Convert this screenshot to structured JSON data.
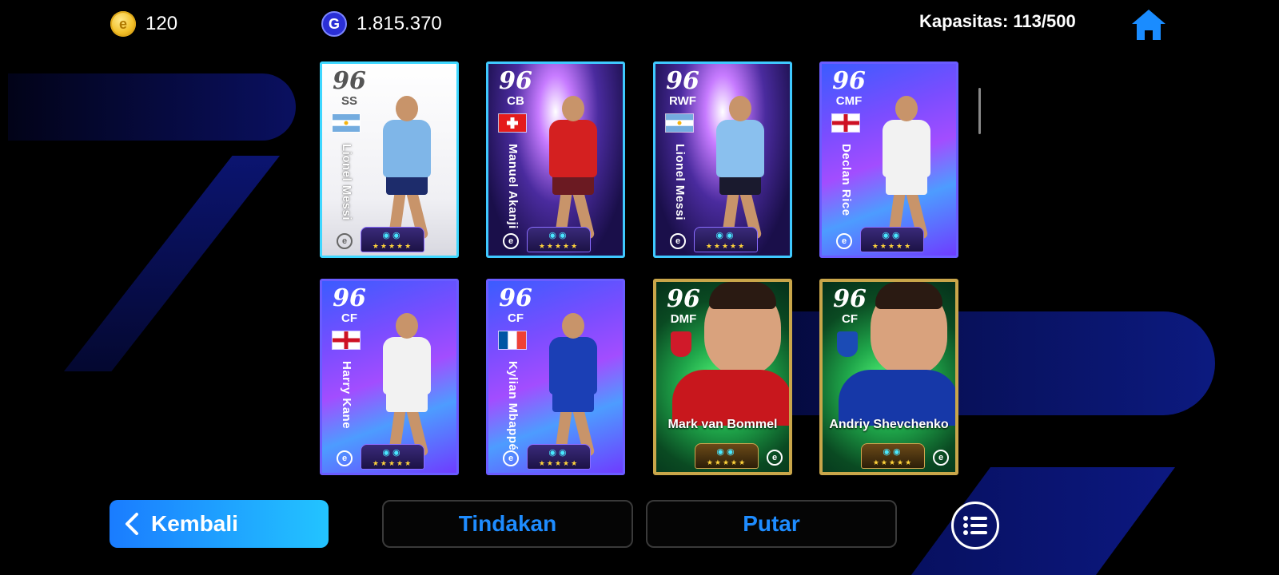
{
  "topbar": {
    "coins": "120",
    "gp": "1.815.370",
    "capacity": "Kapasitas: 113/500",
    "coin_icon": "efootball-coin-icon",
    "gp_icon": "gp-icon",
    "home_icon": "home-icon"
  },
  "cards": [
    {
      "rating": "96",
      "position": "SS",
      "name": "Lionel Messi",
      "style": "white",
      "flag": "argentina",
      "stars": "★★★★★"
    },
    {
      "rating": "96",
      "position": "CB",
      "name": "Manuel Akanji",
      "style": "galaxy",
      "flag": "switzerland",
      "stars": "★★★★★"
    },
    {
      "rating": "96",
      "position": "RWF",
      "name": "Lionel Messi",
      "style": "galaxy",
      "flag": "argentina",
      "stars": "★★★★★"
    },
    {
      "rating": "96",
      "position": "CMF",
      "name": "Declan Rice",
      "style": "neon",
      "flag": "england",
      "stars": "★★★★★"
    },
    {
      "rating": "96",
      "position": "CF",
      "name": "Harry Kane",
      "style": "neon",
      "flag": "england",
      "stars": "★★★★★"
    },
    {
      "rating": "96",
      "position": "CF",
      "name": "Kylian Mbappé",
      "style": "neon",
      "flag": "france",
      "stars": "★★★★★"
    },
    {
      "rating": "96",
      "position": "DMF",
      "name": "Mark van Bommel",
      "style": "green",
      "flag": "club",
      "stars": "★★★★★"
    },
    {
      "rating": "96",
      "position": "CF",
      "name": "Andriy Shevchenko",
      "style": "green",
      "flag": "club",
      "stars": "★★★★★"
    }
  ],
  "buttons": {
    "back": "Kembali",
    "action": "Tindakan",
    "rotate": "Putar",
    "menu_icon": "list-menu-icon"
  },
  "colors": {
    "accent": "#1e8cff",
    "back_gradient_start": "#1a7cff",
    "back_gradient_end": "#23c4ff"
  }
}
